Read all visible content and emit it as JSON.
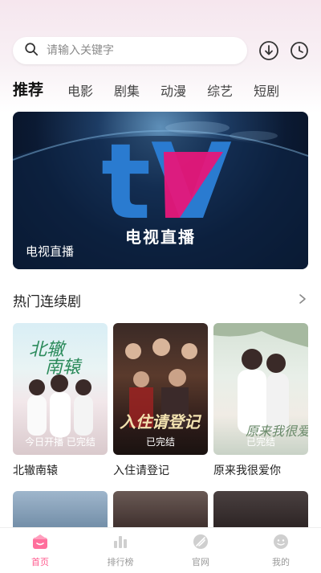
{
  "search": {
    "placeholder": "请输入关键字"
  },
  "header_icons": [
    "download-icon",
    "history-clock-icon"
  ],
  "tabs": [
    {
      "label": "推荐",
      "active": true
    },
    {
      "label": "电影"
    },
    {
      "label": "剧集"
    },
    {
      "label": "动漫"
    },
    {
      "label": "综艺"
    },
    {
      "label": "短剧"
    }
  ],
  "banner": {
    "logo_text": "tV",
    "center_title": "电视直播",
    "caption": "电视直播"
  },
  "section": {
    "title": "热门连续剧"
  },
  "posters": [
    {
      "title": "北辙南辕",
      "status": "今日开播 已完结"
    },
    {
      "title": "入住请登记",
      "status": "已完结"
    },
    {
      "title": "原来我很爱你",
      "status": "已完结"
    }
  ],
  "bottom_nav": [
    {
      "label": "首页",
      "icon": "home-icon",
      "active": true
    },
    {
      "label": "排行榜",
      "icon": "ranking-icon"
    },
    {
      "label": "官网",
      "icon": "website-icon"
    },
    {
      "label": "我的",
      "icon": "profile-icon"
    }
  ],
  "colors": {
    "accent": "#ff5a8e",
    "banner_pink": "#e6177a",
    "banner_blue": "#2a7bd0"
  }
}
